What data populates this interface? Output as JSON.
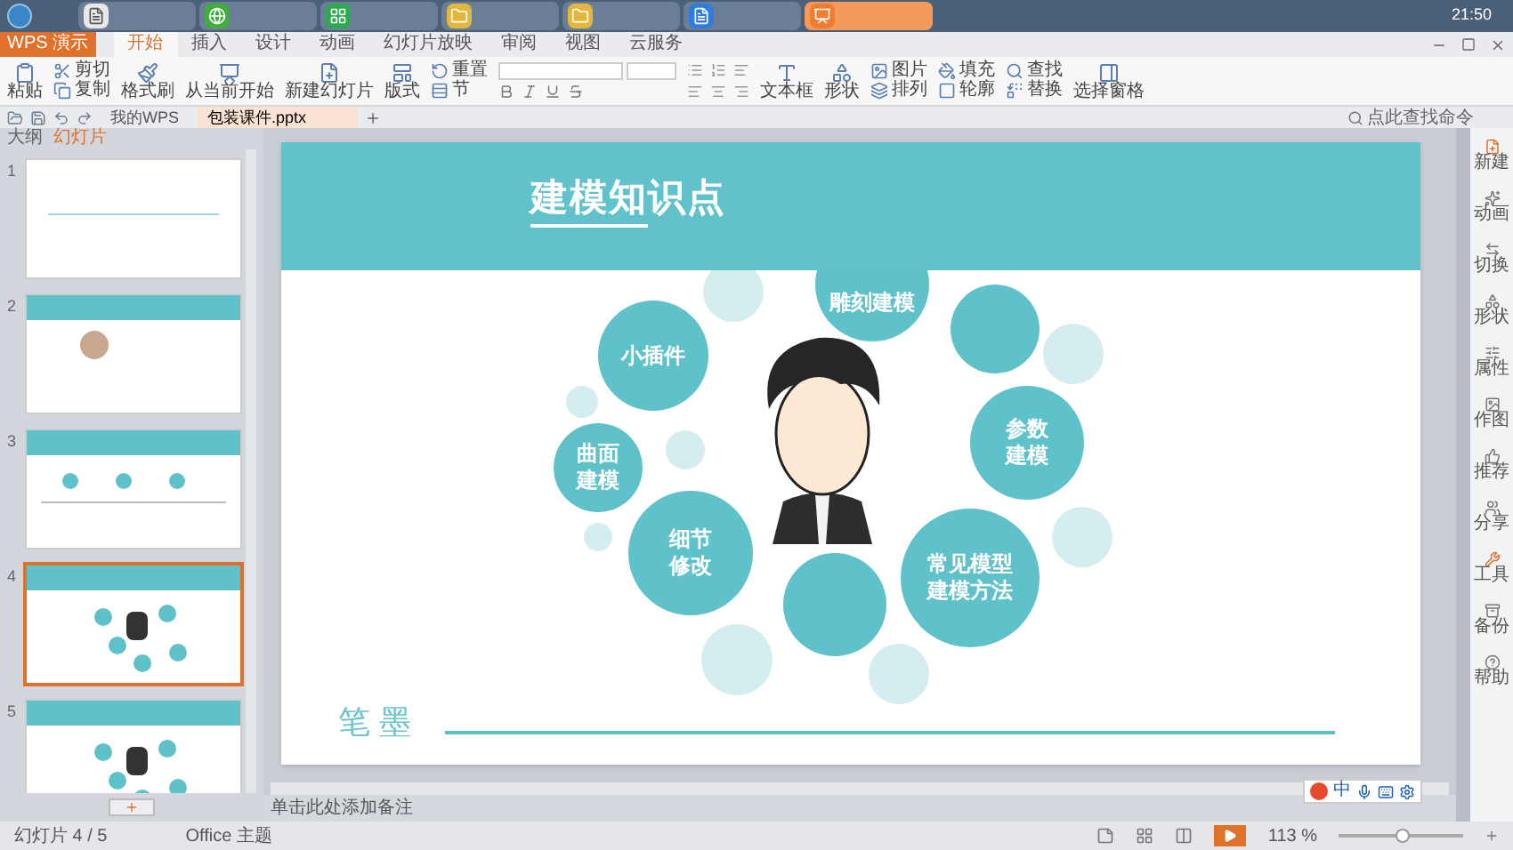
{
  "taskbar": {
    "items": [
      {
        "kind": "document",
        "selected": false
      },
      {
        "kind": "browser",
        "selected": false
      },
      {
        "kind": "sheet",
        "selected": false
      },
      {
        "kind": "folder",
        "selected": false
      },
      {
        "kind": "folder",
        "selected": false
      },
      {
        "kind": "writer",
        "selected": false
      },
      {
        "kind": "presentation",
        "selected": true
      }
    ],
    "time": "21:50"
  },
  "app_menu": {
    "label": "WPS 演示"
  },
  "ribbon_tabs": [
    {
      "label": "开始",
      "selected": true
    },
    {
      "label": "插入",
      "selected": false
    },
    {
      "label": "设计",
      "selected": false
    },
    {
      "label": "动画",
      "selected": false
    },
    {
      "label": "幻灯片放映",
      "selected": false
    },
    {
      "label": "审阅",
      "selected": false
    },
    {
      "label": "视图",
      "selected": false
    },
    {
      "label": "云服务",
      "selected": false
    }
  ],
  "ribbon": [
    {
      "kind": "large",
      "labels": [
        "粘贴"
      ]
    },
    {
      "kind": "stack",
      "labels": [
        "剪切",
        "复制"
      ]
    },
    {
      "kind": "large",
      "labels": [
        "格式刷"
      ]
    },
    {
      "kind": "large",
      "labels": [
        "从当前开始"
      ]
    },
    {
      "kind": "large",
      "labels": [
        "新建幻灯片"
      ]
    },
    {
      "kind": "large",
      "labels": [
        "版式"
      ]
    },
    {
      "kind": "stack",
      "labels": [
        "重置",
        "节"
      ]
    },
    {
      "kind": "font"
    },
    {
      "kind": "paragraph"
    },
    {
      "kind": "large",
      "labels": [
        "文本框"
      ]
    },
    {
      "kind": "large",
      "labels": [
        "形状"
      ]
    },
    {
      "kind": "stack",
      "labels": [
        "图片",
        "排列"
      ]
    },
    {
      "kind": "stack",
      "labels": [
        "填充",
        "轮廓"
      ]
    },
    {
      "kind": "stack",
      "labels": [
        "查找",
        "替换"
      ]
    },
    {
      "kind": "large",
      "labels": [
        "选择窗格"
      ]
    }
  ],
  "doc_tabs": [
    {
      "label": "我的WPS",
      "selected": false
    },
    {
      "label": "包装课件.pptx",
      "selected": true
    }
  ],
  "search": {
    "placeholder": "点此查找命令"
  },
  "panel_tabs": [
    {
      "label": "大纲",
      "selected": false
    },
    {
      "label": "幻灯片",
      "selected": true
    }
  ],
  "slides": [
    {
      "number": "1",
      "kind": "title",
      "selected": false
    },
    {
      "number": "2",
      "kind": "profile",
      "selected": false
    },
    {
      "number": "3",
      "kind": "timeline",
      "selected": false
    },
    {
      "number": "4",
      "kind": "bubbles",
      "selected": true
    },
    {
      "number": "5",
      "kind": "bubbles",
      "selected": false
    }
  ],
  "slide": {
    "title": "建模知识点",
    "footer": "笔 墨",
    "bubbles": [
      {
        "kind": "faint"
      },
      {
        "kind": "filled",
        "lines": [
          "雕刻建模"
        ]
      },
      {
        "kind": "faint"
      },
      {
        "kind": "filled"
      },
      {
        "kind": "filled",
        "lines": [
          "小插件"
        ]
      },
      {
        "kind": "faint"
      },
      {
        "kind": "filled",
        "lines": [
          "参数",
          "建模"
        ]
      },
      {
        "kind": "faint"
      },
      {
        "kind": "filled",
        "lines": [
          "曲面",
          "建模"
        ]
      },
      {
        "kind": "faint"
      },
      {
        "kind": "faint"
      },
      {
        "kind": "filled",
        "lines": [
          "细节",
          "修改"
        ]
      },
      {
        "kind": "filled",
        "lines": [
          "常见模型",
          "建模方法"
        ]
      },
      {
        "kind": "filled"
      },
      {
        "kind": "faint"
      },
      {
        "kind": "faint"
      }
    ]
  },
  "notes": {
    "placeholder": "单击此处添加备注"
  },
  "side_tools": [
    {
      "label": "新建"
    },
    {
      "label": "动画"
    },
    {
      "label": "切换"
    },
    {
      "label": "形状"
    },
    {
      "label": "属性"
    },
    {
      "label": "作图"
    },
    {
      "label": "推荐"
    },
    {
      "label": "分享"
    },
    {
      "label": "工具"
    },
    {
      "label": "备份"
    },
    {
      "label": "帮助"
    }
  ],
  "ime_bar": {
    "mode": "中"
  },
  "status_bar": {
    "slide_counter": "幻灯片 4 / 5",
    "theme": "Office 主题",
    "zoom": "113 %",
    "zoom_slider": {
      "level": 0.52
    }
  }
}
